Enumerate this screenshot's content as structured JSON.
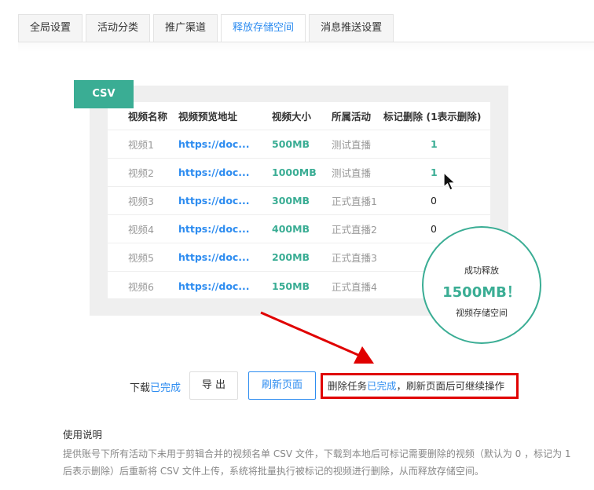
{
  "tabs": [
    {
      "label": "全局设置",
      "active": false
    },
    {
      "label": "活动分类",
      "active": false
    },
    {
      "label": "推广渠道",
      "active": false
    },
    {
      "label": "释放存储空间",
      "active": true
    },
    {
      "label": "消息推送设置",
      "active": false
    }
  ],
  "illustration": {
    "csv_tag": "CSV",
    "headers": [
      "视频名称",
      "视频预览地址",
      "视频大小",
      "所属活动",
      "标记删除 (1表示删除)"
    ],
    "rows": [
      {
        "name": "视频1",
        "url": "https://doc...",
        "size": "500MB",
        "activity": "测试直播",
        "mark": "1"
      },
      {
        "name": "视频2",
        "url": "https://doc...",
        "size": "1000MB",
        "activity": "测试直播",
        "mark": "1"
      },
      {
        "name": "视频3",
        "url": "https://doc...",
        "size": "300MB",
        "activity": "正式直播1",
        "mark": "0"
      },
      {
        "name": "视频4",
        "url": "https://doc...",
        "size": "400MB",
        "activity": "正式直播2",
        "mark": "0"
      },
      {
        "name": "视频5",
        "url": "https://doc...",
        "size": "200MB",
        "activity": "正式直播3",
        "mark": ""
      },
      {
        "name": "视频6",
        "url": "https://doc...",
        "size": "150MB",
        "activity": "正式直播4",
        "mark": ""
      }
    ],
    "circle": {
      "line1": "成功释放",
      "line2": "1500MB！",
      "line3": "视频存储空间"
    }
  },
  "actions": {
    "download_prefix": "下载",
    "download_status": "已完成",
    "export_label": "导 出",
    "refresh_label": "刷新页面",
    "notice_prefix": "删除任务",
    "notice_status": "已完成",
    "notice_suffix": "，刷新页面后可继续操作"
  },
  "usage": {
    "title": "使用说明",
    "text": "提供账号下所有活动下未用于剪辑合并的视频名单 CSV 文件，下载到本地后可标记需要删除的视频（默认为 0 ，标记为 1 后表示删除）后重新将 CSV 文件上传，系统将批量执行被标记的视频进行删除，从而释放存储空间。"
  },
  "colors": {
    "teal": "#3aad94",
    "blue": "#2d8cf0",
    "red": "#e00000"
  }
}
